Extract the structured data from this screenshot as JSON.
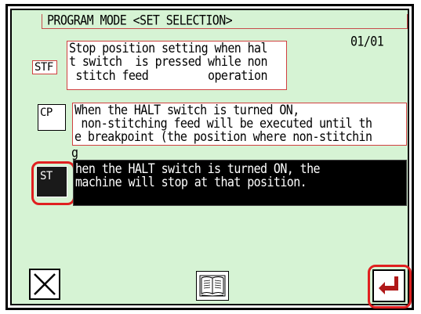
{
  "header": {
    "title": "PROGRAM MODE <SET SELECTION>",
    "page_indicator": "01/01"
  },
  "options": [
    {
      "code": "STF",
      "lines": [
        "Stop position setting when hal",
        "t switch  is pressed while non",
        " stitch feed         operation"
      ],
      "selected": false
    },
    {
      "code": "CP",
      "lines": [
        "When the HALT switch is turned ON,",
        " non-stitching feed will be executed until th",
        "e breakpoint (the position where non-stitchin"
      ],
      "overflow_line": "g",
      "selected": false
    },
    {
      "code": "ST",
      "lines": [
        "hen the HALT switch is turned ON, the",
        "machine will stop at that position."
      ],
      "selected": true
    }
  ],
  "footer": {
    "cancel_icon": "close-x-icon",
    "help_icon": "open-book-icon",
    "enter_icon": "enter-arrow-icon"
  },
  "colors": {
    "background": "#d6f3d4",
    "highlight_outline": "#e02020",
    "text_box_border": "#d04040",
    "enter_arrow": "#b01818"
  }
}
